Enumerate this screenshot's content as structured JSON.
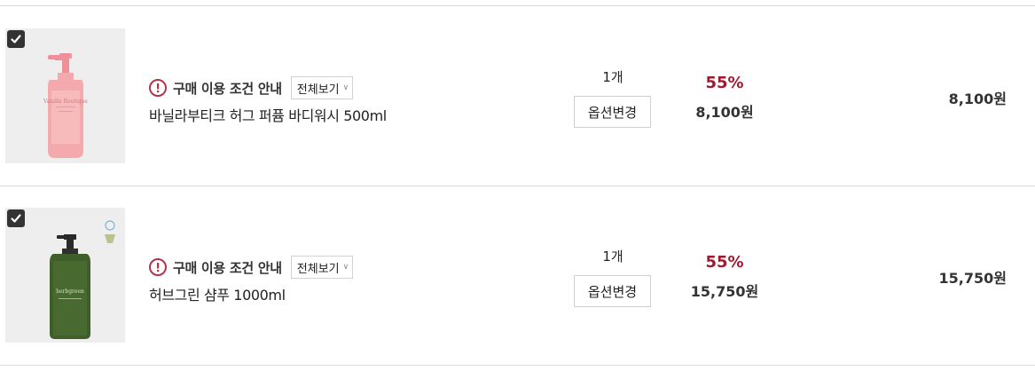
{
  "cart": {
    "items": [
      {
        "checked": true,
        "notice": "구매 이용 조건 안내",
        "dropdown_label": "전체보기",
        "name": "바닐라부티크 허그 퍼퓸 바디워시 500ml",
        "quantity": "1개",
        "option_button": "옵션변경",
        "discount": "55%",
        "sale_price": "8,100원",
        "total": "8,100원",
        "image_label": "Vanilla Boutique",
        "bottle_color": "#f4a9ac"
      },
      {
        "checked": true,
        "notice": "구매 이용 조건 안내",
        "dropdown_label": "전체보기",
        "name": "허브그린 샴푸 1000ml",
        "quantity": "1개",
        "option_button": "옵션변경",
        "discount": "55%",
        "sale_price": "15,750원",
        "total": "15,750원",
        "image_label": "herbgreen",
        "bottle_color": "#3f5e2a"
      }
    ]
  },
  "colors": {
    "accent": "#9e1a31",
    "alert": "#b5344b"
  }
}
